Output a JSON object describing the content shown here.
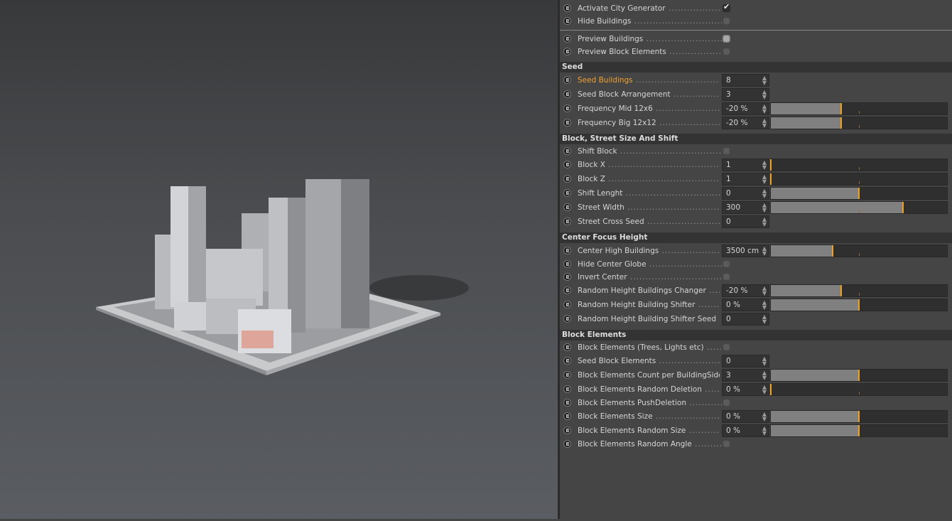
{
  "colors": {
    "accent": "#f0a020",
    "panel": "#454545",
    "field": "#333333"
  },
  "viewport": {
    "content": "3d-city-render"
  },
  "rows": [
    {
      "type": "check",
      "label": "Activate City Generator",
      "checked": true
    },
    {
      "type": "check",
      "label": "Hide Buildings",
      "checked": false
    },
    {
      "type": "separator"
    },
    {
      "type": "check",
      "label": "Preview Buildings",
      "checked": false,
      "hover": true
    },
    {
      "type": "check",
      "label": "Preview Block Elements",
      "checked": false
    },
    {
      "type": "header",
      "label": "Seed"
    },
    {
      "type": "field",
      "label": "Seed Buildings",
      "value": "8",
      "active": true
    },
    {
      "type": "field",
      "label": "Seed Block Arrangement",
      "value": "3"
    },
    {
      "type": "slider",
      "label": "Frequency Mid 12x6",
      "value": "-20 %",
      "level": 0.4
    },
    {
      "type": "slider",
      "label": "Frequency Big 12x12",
      "value": "-20 %",
      "level": 0.4
    },
    {
      "type": "header",
      "label": "Block, Street Size And Shift"
    },
    {
      "type": "check",
      "label": "Shift Block",
      "checked": false
    },
    {
      "type": "slider",
      "label": "Block X",
      "value": "1",
      "level": 0
    },
    {
      "type": "slider",
      "label": "Block Z",
      "value": "1",
      "level": 0
    },
    {
      "type": "slider",
      "label": "Shift Lenght",
      "value": "0",
      "level": 0.5
    },
    {
      "type": "slider",
      "label": "Street Width",
      "value": "300",
      "level": 0.75
    },
    {
      "type": "field",
      "label": "Street Cross Seed",
      "value": "0"
    },
    {
      "type": "header",
      "label": "Center Focus Height"
    },
    {
      "type": "slider",
      "label": "Center High Buildings",
      "value": "3500 cm",
      "level": 0.35
    },
    {
      "type": "check",
      "label": "Hide Center Globe",
      "checked": false
    },
    {
      "type": "check",
      "label": "Invert Center",
      "checked": false
    },
    {
      "type": "slider",
      "label": "Random Height Buildings Changer",
      "value": "-20 %",
      "level": 0.4
    },
    {
      "type": "slider",
      "label": "Random Height Building Shifter",
      "value": "0 %",
      "level": 0.5
    },
    {
      "type": "field",
      "label": "Random Height Building Shifter Seed",
      "value": "0"
    },
    {
      "type": "header",
      "label": "Block Elements"
    },
    {
      "type": "check",
      "label": "Block Elements (Trees, Lights etc)",
      "checked": false
    },
    {
      "type": "field",
      "label": "Seed Block Elements",
      "value": "0"
    },
    {
      "type": "slider",
      "label": "Block Elements Count per BuildingSide",
      "value": "3",
      "level": 0.5
    },
    {
      "type": "slider",
      "label": "Block Elements Random Deletion",
      "value": "0 %",
      "level": 0
    },
    {
      "type": "check",
      "label": "Block Elements PushDeletion",
      "checked": false
    },
    {
      "type": "slider",
      "label": "Block Elements Size",
      "value": "0 %",
      "level": 0.5
    },
    {
      "type": "slider",
      "label": "Block Elements Random Size",
      "value": "0 %",
      "level": 0.5
    },
    {
      "type": "check",
      "label": "Block Elements Random Angle",
      "checked": false
    }
  ]
}
